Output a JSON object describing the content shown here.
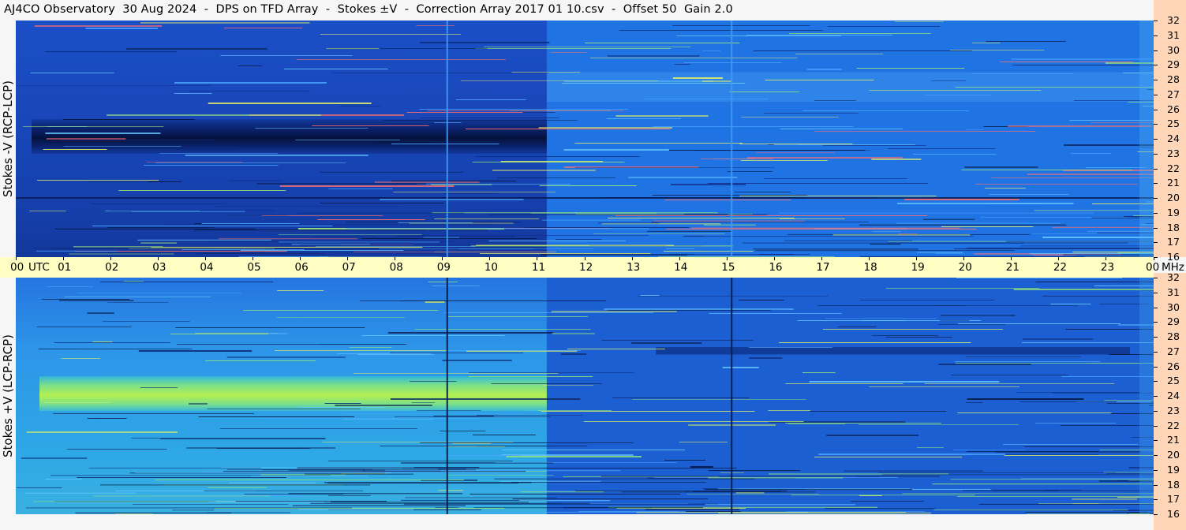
{
  "title": "AJ4CO Observatory  30 Aug 2024  -  DPS on TFD Array  -  Stokes ±V  -  Correction Array 2017 01 10.csv  -  Offset 50  Gain 2.0",
  "panels": {
    "top_label": "Stokes -V (RCP-LCP)",
    "bottom_label": "Stokes +V (LCP-RCP)"
  },
  "time_axis": {
    "ticks": [
      "00",
      "01",
      "02",
      "03",
      "04",
      "05",
      "06",
      "07",
      "08",
      "09",
      "10",
      "11",
      "12",
      "13",
      "14",
      "15",
      "16",
      "17",
      "18",
      "19",
      "20",
      "21",
      "22",
      "23",
      "00"
    ],
    "start_unit": "UTC",
    "end_unit": "MHz"
  },
  "freq_axis": {
    "ticks": [
      "32",
      "31",
      "30",
      "29",
      "28",
      "27",
      "26",
      "25",
      "24",
      "23",
      "22",
      "21",
      "20",
      "19",
      "18",
      "17",
      "16"
    ]
  },
  "colors": {
    "page_bg": "#f6f6f6",
    "time_axis_bg": "#ffffc4",
    "freq_axis_bg": "#ffd7b8"
  },
  "chart_data": [
    {
      "type": "heatmap",
      "name": "Stokes -V (RCP-LCP)",
      "x_unit": "UTC hour",
      "xlim": [
        0,
        24
      ],
      "y_unit": "MHz",
      "ylim": [
        16,
        32
      ],
      "features": [
        {
          "kind": "dark_band",
          "t_start": 0.0,
          "t_end": 11.2,
          "f_start": 23.3,
          "f_end": 25.0
        },
        {
          "kind": "dark_background",
          "t_start": 0.0,
          "t_end": 11.2
        },
        {
          "kind": "vertical_line",
          "t": 9.1
        },
        {
          "kind": "vertical_line",
          "t": 15.1
        },
        {
          "kind": "horizontal_interference",
          "f": 20.0
        }
      ]
    },
    {
      "type": "heatmap",
      "name": "Stokes +V (LCP-RCP)",
      "x_unit": "UTC hour",
      "xlim": [
        0,
        24
      ],
      "y_unit": "MHz",
      "ylim": [
        16,
        32
      ],
      "features": [
        {
          "kind": "bright_band",
          "t_start": 0.0,
          "t_end": 11.2,
          "f_start": 23.3,
          "f_end": 25.0
        },
        {
          "kind": "bright_background",
          "t_start": 0.0,
          "t_end": 11.2
        },
        {
          "kind": "vertical_line",
          "t": 9.1
        },
        {
          "kind": "vertical_line",
          "t": 15.1
        },
        {
          "kind": "dark_band",
          "t_start": 13.5,
          "t_end": 23.5,
          "f_start": 26.8,
          "f_end": 27.3
        }
      ]
    }
  ]
}
